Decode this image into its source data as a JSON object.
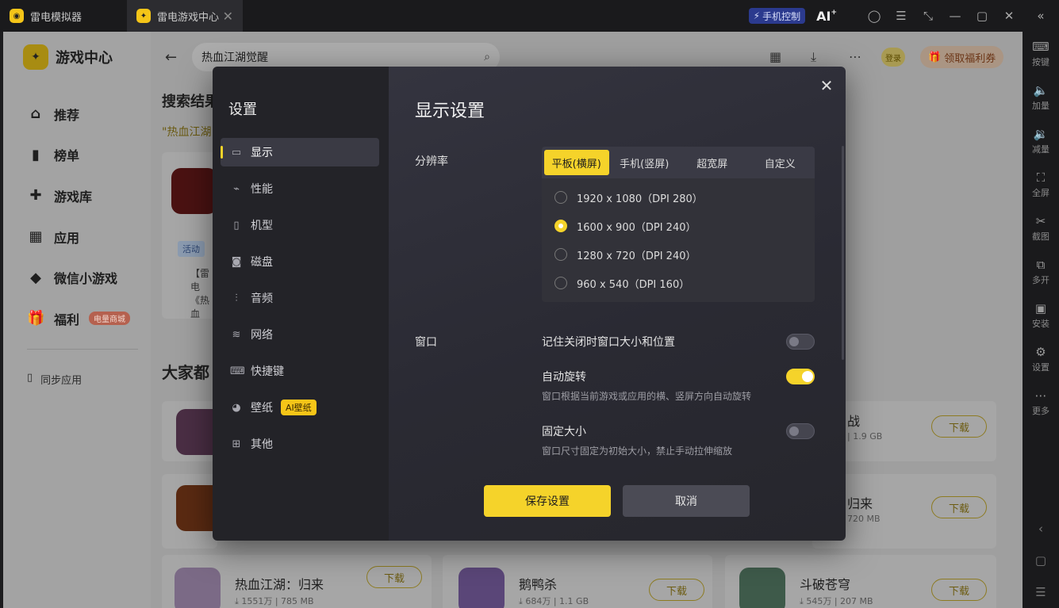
{
  "window": {
    "tabs": [
      {
        "label": "雷电模拟器"
      },
      {
        "label": "雷电游戏中心"
      }
    ],
    "phone_control": "手机控制",
    "ai_label": "AI"
  },
  "right_toolbar": {
    "items": [
      {
        "label": "按键",
        "icon": "keyboard-icon"
      },
      {
        "label": "加量",
        "icon": "volume-up-icon"
      },
      {
        "label": "减量",
        "icon": "volume-down-icon"
      },
      {
        "label": "全屏",
        "icon": "fullscreen-icon"
      },
      {
        "label": "截图",
        "icon": "scissors-icon"
      },
      {
        "label": "多开",
        "icon": "multi-instance-icon"
      },
      {
        "label": "安装",
        "icon": "install-icon"
      },
      {
        "label": "设置",
        "icon": "gear-icon"
      },
      {
        "label": "更多",
        "icon": "more-icon"
      }
    ]
  },
  "game_center": {
    "brand": "游戏中心",
    "nav": [
      {
        "label": "推荐"
      },
      {
        "label": "榜单"
      },
      {
        "label": "游戏库"
      },
      {
        "label": "应用"
      },
      {
        "label": "微信小游戏"
      },
      {
        "label": "福利",
        "badge": "电量商城"
      }
    ],
    "sync_label": "同步应用",
    "search_value": "热血江湖觉醒",
    "login": "登录",
    "coupon": "领取福利券",
    "search_results_heading": "搜索结果",
    "query_quote": "\"热血江湖",
    "activity_tag": "活动",
    "snippet_1": "【雷电",
    "snippet_2": "《热血",
    "everyone_heading": "大家都",
    "download": "下载",
    "games": [
      {
        "name": "战",
        "meta": "| 1.9 GB"
      },
      {
        "name": "归来",
        "meta": "720 MB"
      },
      {
        "name": "热血江湖：归来",
        "meta": "⤓ 1551万 | 785 MB"
      },
      {
        "name": "鹅鸭杀",
        "meta": "⤓ 684万 | 1.1 GB"
      },
      {
        "name": "斗破苍穹",
        "meta": "⤓ 545万 | 207 MB"
      }
    ]
  },
  "settings": {
    "title": "设置",
    "nav": [
      {
        "label": "显示",
        "icon": "monitor-icon"
      },
      {
        "label": "性能",
        "icon": "performance-icon"
      },
      {
        "label": "机型",
        "icon": "phone-icon"
      },
      {
        "label": "磁盘",
        "icon": "disk-icon"
      },
      {
        "label": "音频",
        "icon": "audio-icon"
      },
      {
        "label": "网络",
        "icon": "wifi-icon"
      },
      {
        "label": "快捷键",
        "icon": "keyboard-icon"
      },
      {
        "label": "壁纸",
        "icon": "palette-icon",
        "badge": "AI壁纸"
      },
      {
        "label": "其他",
        "icon": "grid-icon"
      }
    ],
    "section_title": "显示设置",
    "resolution_label": "分辨率",
    "resolution_tabs": [
      "平板(横屏)",
      "手机(竖屏)",
      "超宽屏",
      "自定义"
    ],
    "resolution_options": [
      {
        "label": "1920 x 1080（DPI 280）",
        "selected": false
      },
      {
        "label": "1600 x 900（DPI 240）",
        "selected": true
      },
      {
        "label": "1280 x 720（DPI 240）",
        "selected": false
      },
      {
        "label": "960 x 540（DPI 160）",
        "selected": false
      }
    ],
    "window_label": "窗口",
    "options": [
      {
        "title": "记住关闭时窗口大小和位置",
        "desc": "",
        "on": false
      },
      {
        "title": "自动旋转",
        "desc": "窗口根据当前游戏或应用的横、竖屏方向自动旋转",
        "on": true
      },
      {
        "title": "固定大小",
        "desc": "窗口尺寸固定为初始大小，禁止手动拉伸缩放",
        "on": false
      }
    ],
    "save": "保存设置",
    "cancel": "取消"
  },
  "colors": {
    "accent": "#f5d32a",
    "phone_control_bg": "#2b3a8e"
  }
}
